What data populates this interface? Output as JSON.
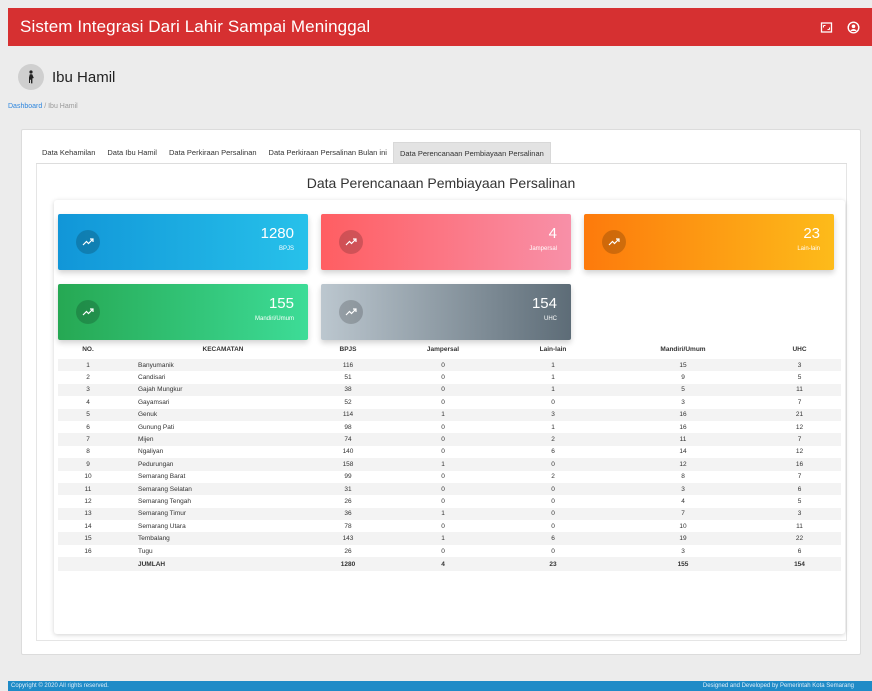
{
  "app": {
    "title": "Sistem Integrasi Dari Lahir Sampai Meninggal"
  },
  "page": {
    "title": "Ibu Hamil"
  },
  "breadcrumb": {
    "home": "Dashboard",
    "sep": "/",
    "current": "Ibu Hamil"
  },
  "tabs": [
    {
      "label": "Data Kehamilan"
    },
    {
      "label": "Data Ibu Hamil"
    },
    {
      "label": "Data Perkiraan Persalinan"
    },
    {
      "label": "Data Perkiraan Persalinan Bulan ini"
    },
    {
      "label": "Data Perencanaan Pembiayaan Persalinan",
      "active": true
    }
  ],
  "section": {
    "title": "Data Perencanaan Pembiayaan Persalinan"
  },
  "stats": [
    {
      "value": "1280",
      "label": "BPJS",
      "colors": [
        "#1196d8",
        "#27c1ea"
      ]
    },
    {
      "value": "4",
      "label": "Jampersal",
      "colors": [
        "#ff5e62",
        "#f890a8"
      ]
    },
    {
      "value": "23",
      "label": "Lain-lain",
      "colors": [
        "#fd7a0c",
        "#fdbb1a"
      ]
    },
    {
      "value": "155",
      "label": "Mandiri/Umum",
      "colors": [
        "#26a853",
        "#3ddc97"
      ]
    },
    {
      "value": "154",
      "label": "UHC",
      "colors": [
        "#bcc7cf",
        "#5d6c77"
      ]
    }
  ],
  "table": {
    "headers": [
      "NO.",
      "KECAMATAN",
      "BPJS",
      "Jampersal",
      "Lain-lain",
      "Mandiri/Umum",
      "UHC"
    ],
    "rows": [
      [
        "1",
        "Banyumanik",
        "116",
        "0",
        "1",
        "15",
        "3"
      ],
      [
        "2",
        "Candisari",
        "51",
        "0",
        "1",
        "9",
        "5"
      ],
      [
        "3",
        "Gajah Mungkur",
        "38",
        "0",
        "1",
        "5",
        "11"
      ],
      [
        "4",
        "Gayamsari",
        "52",
        "0",
        "0",
        "3",
        "7"
      ],
      [
        "5",
        "Genuk",
        "114",
        "1",
        "3",
        "16",
        "21"
      ],
      [
        "6",
        "Gunung Pati",
        "98",
        "0",
        "1",
        "16",
        "12"
      ],
      [
        "7",
        "Mijen",
        "74",
        "0",
        "2",
        "11",
        "7"
      ],
      [
        "8",
        "Ngaliyan",
        "140",
        "0",
        "6",
        "14",
        "12"
      ],
      [
        "9",
        "Pedurungan",
        "158",
        "1",
        "0",
        "12",
        "16"
      ],
      [
        "10",
        "Semarang Barat",
        "99",
        "0",
        "2",
        "8",
        "7"
      ],
      [
        "11",
        "Semarang Selatan",
        "31",
        "0",
        "0",
        "3",
        "6"
      ],
      [
        "12",
        "Semarang Tengah",
        "26",
        "0",
        "0",
        "4",
        "5"
      ],
      [
        "13",
        "Semarang Timur",
        "36",
        "1",
        "0",
        "7",
        "3"
      ],
      [
        "14",
        "Semarang Utara",
        "78",
        "0",
        "0",
        "10",
        "11"
      ],
      [
        "15",
        "Tembalang",
        "143",
        "1",
        "6",
        "19",
        "22"
      ],
      [
        "16",
        "Tugu",
        "26",
        "0",
        "0",
        "3",
        "6"
      ]
    ],
    "total": [
      "",
      "JUMLAH",
      "1280",
      "4",
      "23",
      "155",
      "154"
    ]
  },
  "footer": {
    "left": "Copyright © 2020 All rights reserved.",
    "right": "Designed and Developed by Pemerintah Kota Semarang"
  },
  "icons": {
    "header": [
      "fullscreen-icon",
      "user-account-icon"
    ],
    "page": "pregnant-woman-icon",
    "stat": "trending-up-icon"
  }
}
